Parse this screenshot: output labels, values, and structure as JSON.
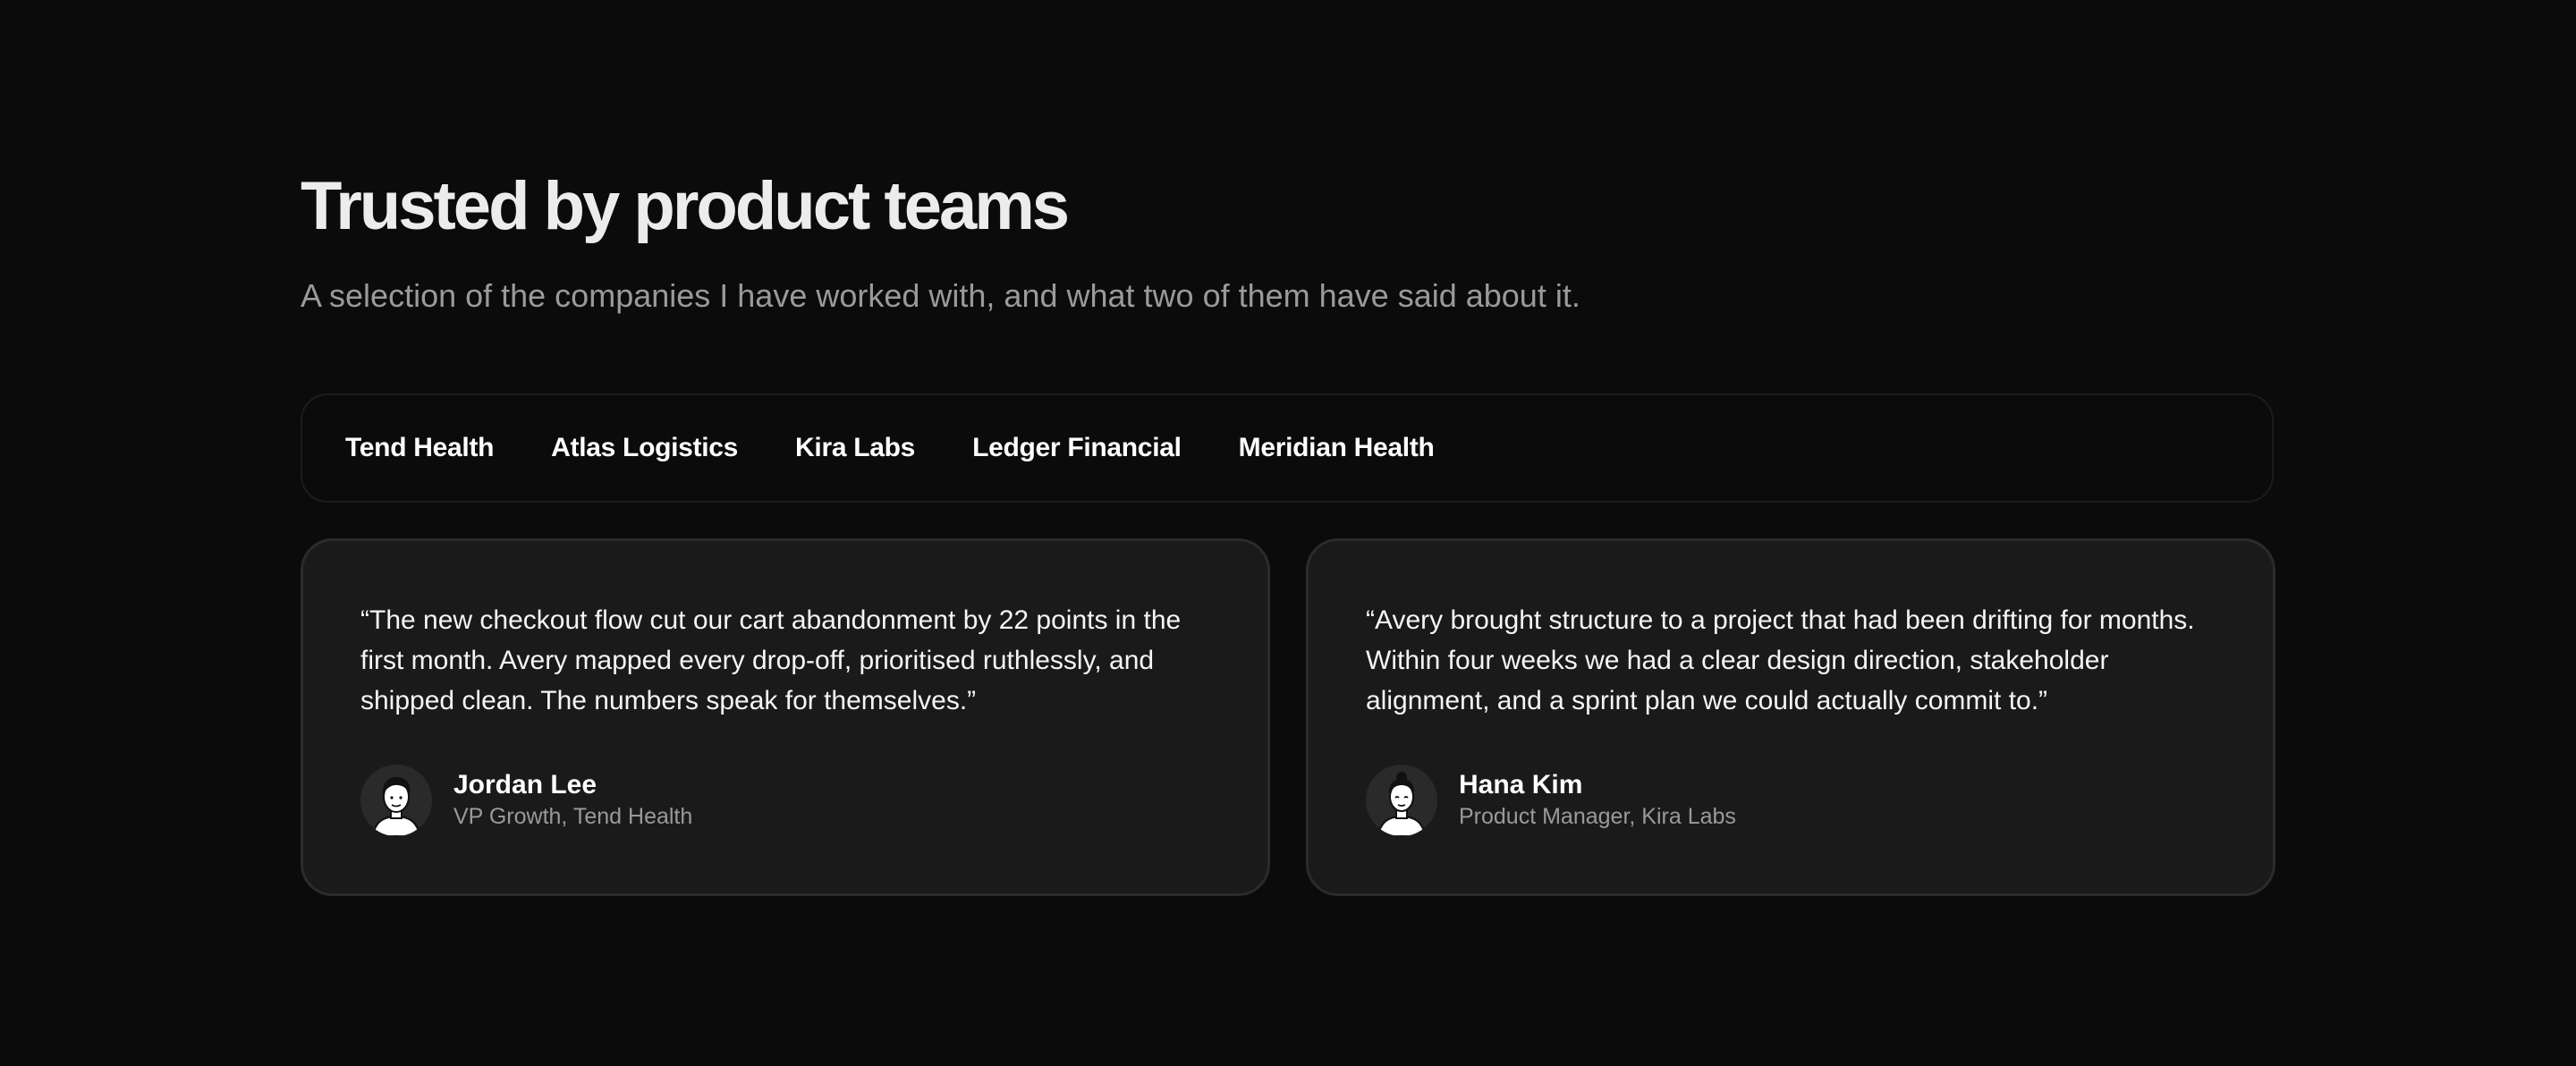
{
  "section": {
    "title": "Trusted by product teams",
    "subtitle": "A selection of the companies I have worked with, and what two of them have said about it."
  },
  "logos": [
    {
      "label": "Tend Health"
    },
    {
      "label": "Atlas Logistics"
    },
    {
      "label": "Kira Labs"
    },
    {
      "label": "Ledger Financial"
    },
    {
      "label": "Meridian Health"
    }
  ],
  "testimonials": [
    {
      "quote": "“The new checkout flow cut our cart abandonment by 22 points in the first month. Avery mapped every drop-off, prioritised ruthlessly, and shipped clean. The numbers speak for themselves.”",
      "name": "Jordan Lee",
      "role": "VP Growth, Tend Health",
      "avatar_icon": "person-illustration-icon"
    },
    {
      "quote": "“Avery brought structure to a project that had been drifting for months. Within four weeks we had a clear design direction, stakeholder alignment, and a sprint plan we could actually commit to.”",
      "name": "Hana Kim",
      "role": "Product Manager, Kira Labs",
      "avatar_icon": "person-illustration-icon"
    }
  ],
  "colors": {
    "background": "#0b0b0b",
    "card": "#1a1a1a",
    "card_border": "#2b2b2b",
    "muted_text": "#9a9a9a"
  }
}
